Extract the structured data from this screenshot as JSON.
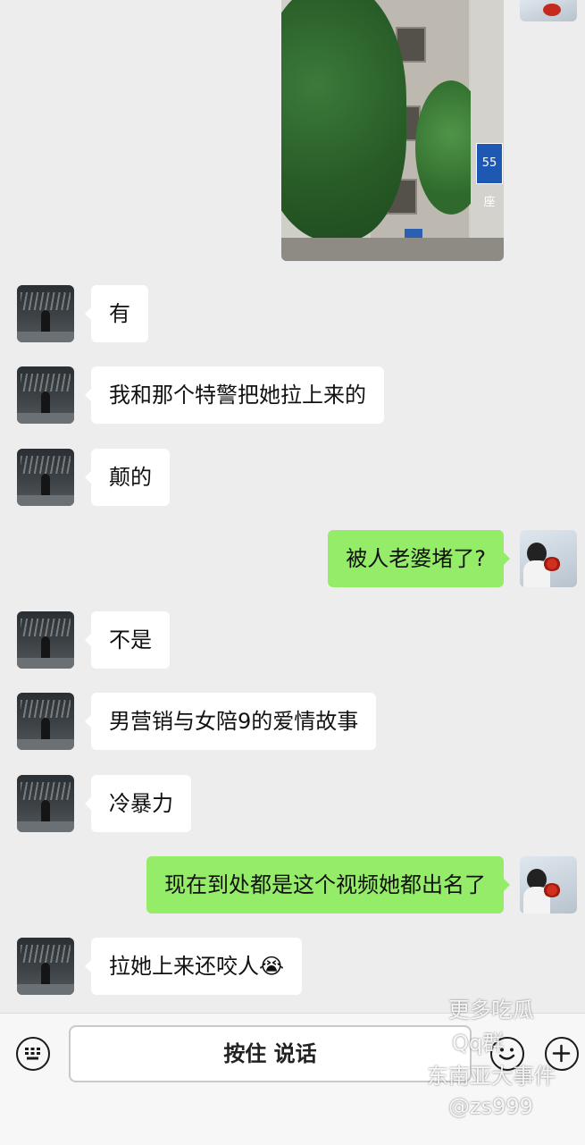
{
  "messages": [
    {
      "side": "left",
      "text": "有"
    },
    {
      "side": "left",
      "text": "我和那个特警把她拉上来的"
    },
    {
      "side": "left",
      "text": "颠的"
    },
    {
      "side": "right",
      "text": "被人老婆堵了?"
    },
    {
      "side": "left",
      "text": "不是"
    },
    {
      "side": "left",
      "text": "男营销与女陪9的爱情故事"
    },
    {
      "side": "left",
      "text": "冷暴力"
    },
    {
      "side": "right",
      "text": "现在到处都是这个视频她都出名了"
    },
    {
      "side": "left",
      "text": "拉她上来还咬人😭"
    }
  ],
  "photo": {
    "sign_text": "55座"
  },
  "toolbar": {
    "hold_to_talk_label": "按住 说话",
    "keyboard_icon": "keyboard-icon",
    "emoji_icon": "emoji-icon",
    "plus_icon": "plus-icon"
  },
  "watermark": {
    "line1": "更多吃瓜",
    "line2": "Qq群",
    "line3": "东南亚大事件",
    "line4": "@zs999"
  },
  "colors": {
    "background": "#ededed",
    "incoming_bubble": "#ffffff",
    "outgoing_bubble": "#95ec69"
  }
}
